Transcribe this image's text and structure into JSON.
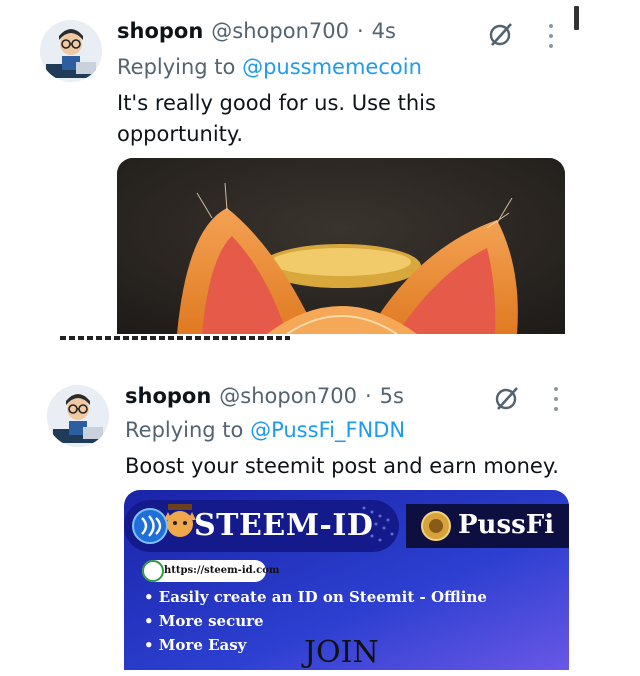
{
  "tweets": [
    {
      "name": "shopon",
      "handle": "@shopon700",
      "dot": "·",
      "time": "4s",
      "replying_prefix": "Replying to ",
      "replying_to": "@pussmemecoin",
      "text": "It's really good for us. Use this opportunity.",
      "avatar_icon": "developer-avatar",
      "media_description_icon": "cat-ears-image"
    },
    {
      "name": "shopon",
      "handle": "@shopon700",
      "dot": "·",
      "time": "5s",
      "replying_prefix": "Replying to ",
      "replying_to": "@PussFi_FNDN",
      "text": "Boost your steemit post and earn money.",
      "avatar_icon": "developer-avatar",
      "banner": {
        "title": "STEEM-ID",
        "brand": "PussFi",
        "url": "https://steem-id.com",
        "bullets": [
          "• Easily create an ID on Steemit - Offline",
          "• More secure",
          "• More Easy"
        ],
        "cta": "JOIN"
      }
    }
  ],
  "colors": {
    "link": "#1d9bf0",
    "secondary": "#536471",
    "primary": "#0f1419",
    "banner_blue": "#1f2fb5"
  }
}
